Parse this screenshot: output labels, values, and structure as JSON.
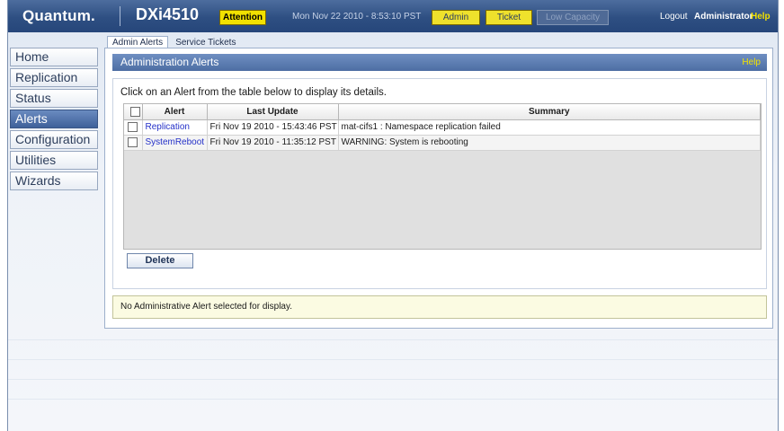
{
  "header": {
    "logo": "Quantum.",
    "model": "DXi4510",
    "attention_label": "Attention",
    "datetime": "Mon Nov 22 2010 - 8:53:10 PST",
    "admin_label": "Admin",
    "ticket_label": "Ticket",
    "low_capacity_label": "Low Capacity",
    "logout_label": "Logout",
    "user": "Administrator",
    "help_label": "Help"
  },
  "sidebar": {
    "items": [
      {
        "label": "Home"
      },
      {
        "label": "Replication"
      },
      {
        "label": "Status"
      },
      {
        "label": "Alerts",
        "active": true
      },
      {
        "label": "Configuration"
      },
      {
        "label": "Utilities"
      },
      {
        "label": "Wizards"
      }
    ]
  },
  "subtabs": [
    {
      "label": "Admin Alerts",
      "active": true
    },
    {
      "label": "Service Tickets"
    }
  ],
  "panel": {
    "title": "Administration Alerts",
    "help_label": "Help",
    "instructions": "Click on an Alert from the table below to display its details.",
    "table": {
      "columns": [
        "Alert",
        "Last Update",
        "Summary"
      ],
      "rows": [
        {
          "alert": "Replication",
          "last_update": "Fri Nov 19 2010 - 15:43:46 PST",
          "summary": "mat-cifs1 : Namespace replication failed"
        },
        {
          "alert": "SystemReboot",
          "last_update": "Fri Nov 19 2010 - 11:35:12 PST",
          "summary": "WARNING: System is rebooting"
        }
      ]
    },
    "delete_label": "Delete",
    "detail_text": "No Administrative Alert selected for display."
  },
  "colors": {
    "header_bg": "#2e4f82",
    "accent_yellow": "#f2e100",
    "nav_active": "#4f70a8",
    "link": "#2430c8"
  }
}
